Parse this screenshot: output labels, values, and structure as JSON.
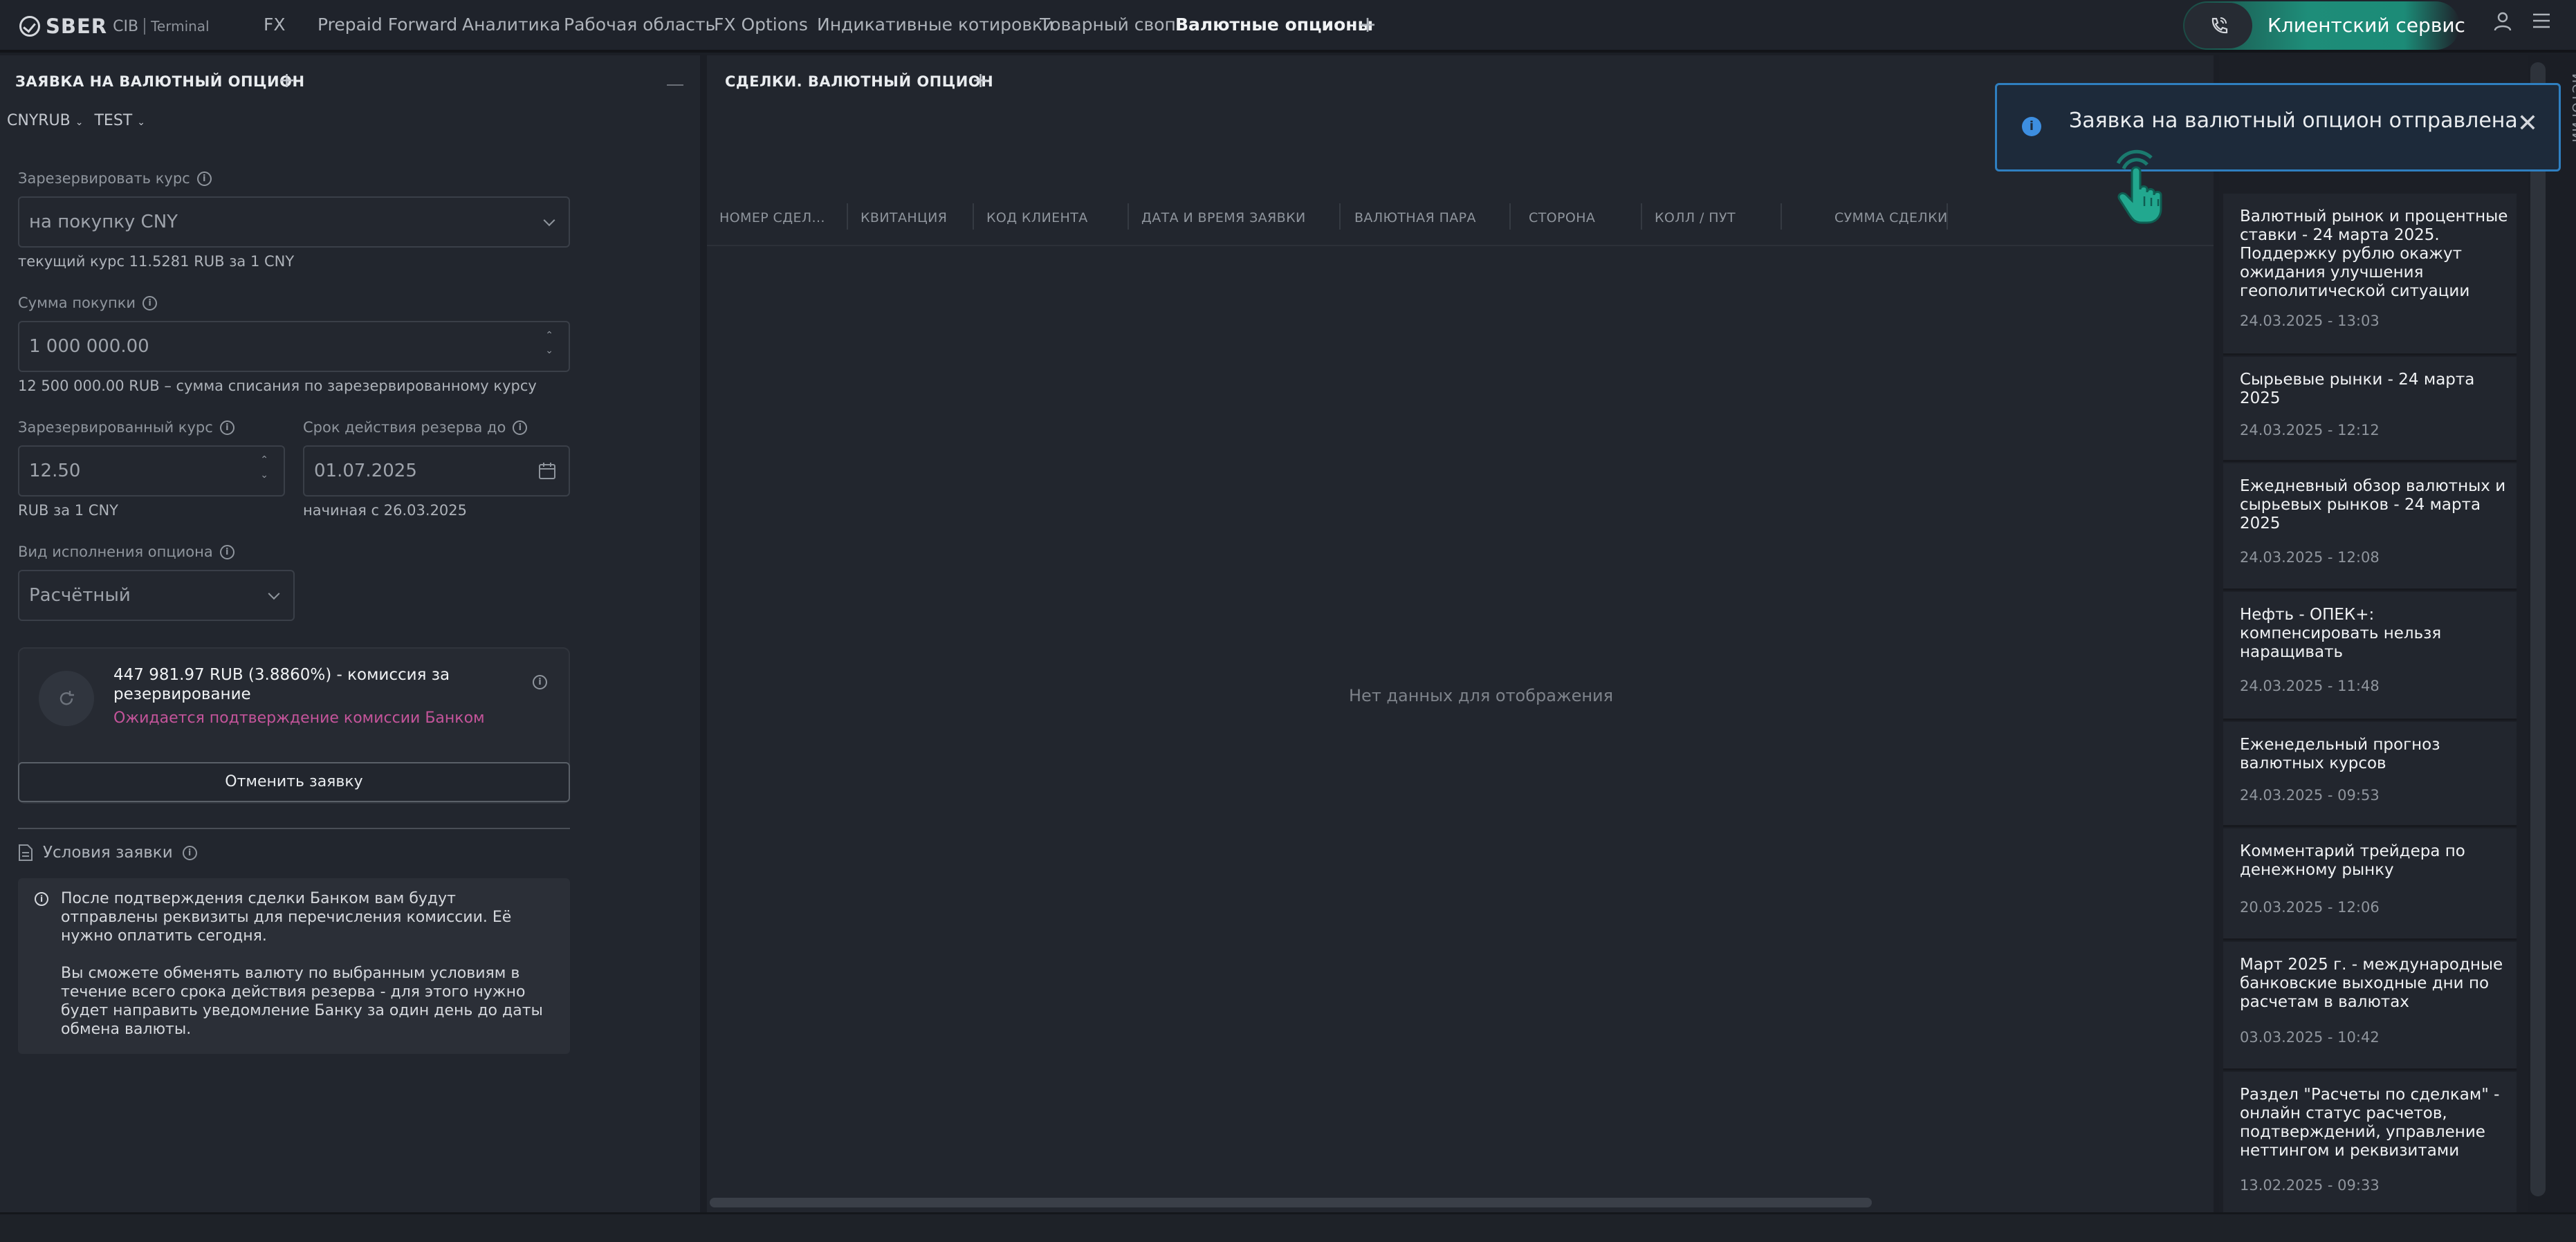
{
  "header": {
    "logo": {
      "brand": "SBER",
      "sub": "CIB",
      "product": "Terminal"
    },
    "nav": [
      {
        "label": "FX"
      },
      {
        "label": "Prepaid Forward"
      },
      {
        "label": "Аналитика"
      },
      {
        "label": "Рабочая область"
      },
      {
        "label": "FX Options"
      },
      {
        "label": "Индикативные котировки"
      },
      {
        "label": "Товарный своп"
      },
      {
        "label": "Валютные опционы",
        "active": true
      }
    ],
    "add_tab_label": "+",
    "client_service_label": "Клиентский сервис",
    "accent_color": "#1e8d79"
  },
  "request_panel": {
    "title": "ЗАЯВКА НА ВАЛЮТНЫЙ ОПЦИОН",
    "add_label": "+",
    "pair": "CNYRUB",
    "account": "TEST",
    "reserve_rate_label": "Зарезервировать курс",
    "reserve_rate_value": "на покупку CNY",
    "current_rate_hint": "текущий курс 11.5281 RUB за 1 CNY",
    "purchase_amount_label": "Сумма покупки",
    "purchase_amount_value": "1 000 000.00",
    "purchase_amount_hint": "12 500 000.00 RUB – сумма списания по зарезервированному курсу",
    "reserved_rate_label": "Зарезервированный курс",
    "reserved_rate_value": "12.50",
    "reserved_rate_hint": "RUB за 1 CNY",
    "reserve_term_label": "Срок действия резерва до",
    "reserve_term_value": "01.07.2025",
    "reserve_term_hint": "начиная с 26.03.2025",
    "execution_label": "Вид исполнения опциона",
    "execution_value": "Расчётный",
    "commission_text": "447 981.97 RUB (3.8860%) - комиссия за резервирование",
    "commission_status": "Ожидается подтверждение комиссии Банком",
    "commission_status_color": "#c4549a",
    "cancel_button": "Отменить заявку",
    "conditions_label": "Условия заявки",
    "notice_p1": "После подтверждения сделки Банком вам будут отправлены реквизиты для перечисления комиссии. Её нужно оплатить сегодня.",
    "notice_p2": "Вы сможете обменять валюту по выбранным условиям в течение всего срока действия резерва - для этого нужно будет направить уведомление Банку за один день до даты обмена валюты."
  },
  "deals_panel": {
    "title": "СДЕЛКИ. ВАЛЮТНЫЙ ОПЦИОН",
    "add_label": "+",
    "columns": [
      "НОМЕР СДЕЛ...",
      "КВИТАНЦИЯ",
      "КОД КЛИЕНТА",
      "ДАТА И ВРЕМЯ ЗАЯВКИ",
      "ВАЛЮТНАЯ ПАРА",
      "СТОРОНА",
      "КОЛЛ / ПУТ",
      "СУММА СДЕЛКИ"
    ],
    "empty_text": "Нет данных для отображения"
  },
  "news": {
    "side_tab": "ИСТОРИИ",
    "items": [
      {
        "title": "Валютный рынок и процентные ставки - 24 марта 2025. Поддержку рублю окажут ожидания улучшения геополитической ситуации",
        "date": "24.03.2025 - 13:03"
      },
      {
        "title": "Сырьевые рынки - 24 марта 2025",
        "date": "24.03.2025 - 12:12"
      },
      {
        "title": "Ежедневный обзор валютных и сырьевых рынков - 24 марта 2025",
        "date": "24.03.2025 - 12:08"
      },
      {
        "title": "Нефть - ОПЕК+: компенсировать нельзя наращивать",
        "date": "24.03.2025 - 11:48"
      },
      {
        "title": "Еженедельный прогноз валютных курсов",
        "date": "24.03.2025 - 09:53"
      },
      {
        "title": "Комментарий трейдера по денежному рынку",
        "date": "20.03.2025 - 12:06"
      },
      {
        "title": "Март 2025 г. - международные банковские выходные дни по расчетам в валютах",
        "date": "03.03.2025 - 10:42"
      },
      {
        "title": "Раздел \"Расчеты по сделкам\" - онлайн статус расчетов, подтверждений, управление неттингом и реквизитами",
        "date": "13.02.2025 - 09:33"
      }
    ]
  },
  "toast": {
    "message": "Заявка на валютный опцион отправлена",
    "color": "#2f7fc0"
  }
}
